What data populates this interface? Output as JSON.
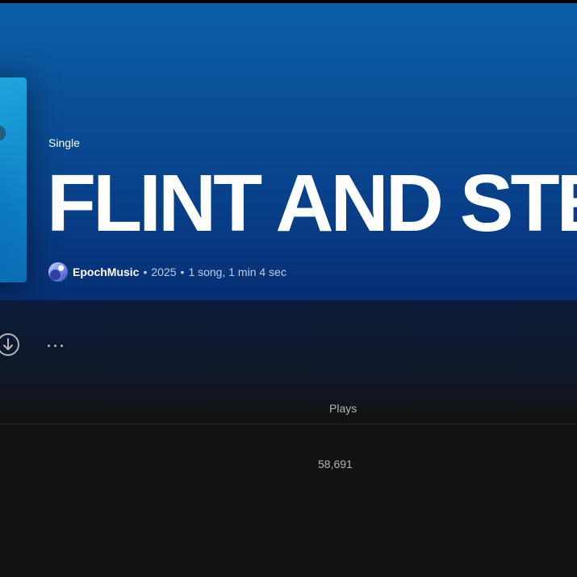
{
  "album": {
    "type_label": "Single",
    "title": "FLINT AND STEEL",
    "artist": "EpochMusic",
    "year": "2025",
    "summary": "1 song, 1 min 4 sec",
    "separator": "•"
  },
  "actions": {
    "download_icon": "download-icon",
    "more_icon": "more-options-icon"
  },
  "tracklist": {
    "columns": {
      "plays": "Plays"
    },
    "rows": [
      {
        "plays": "58,691"
      }
    ]
  },
  "colors": {
    "header_top": "#0a5fa6",
    "header_bottom": "#062f73",
    "background": "#121212",
    "text_secondary": "#b3b3b3"
  }
}
